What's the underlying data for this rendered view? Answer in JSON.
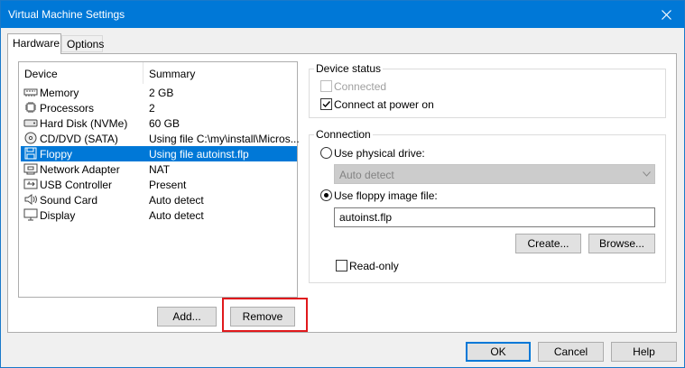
{
  "window": {
    "title": "Virtual Machine Settings"
  },
  "tabs": [
    {
      "label": "Hardware",
      "active": true
    },
    {
      "label": "Options",
      "active": false
    }
  ],
  "device_list": {
    "columns": [
      "Device",
      "Summary"
    ],
    "rows": [
      {
        "device": "Memory",
        "summary": "2 GB",
        "icon": "memory-icon"
      },
      {
        "device": "Processors",
        "summary": "2",
        "icon": "processor-icon"
      },
      {
        "device": "Hard Disk (NVMe)",
        "summary": "60 GB",
        "icon": "hard-disk-icon"
      },
      {
        "device": "CD/DVD (SATA)",
        "summary": "Using file C:\\my\\install\\Micros...",
        "icon": "cd-dvd-icon"
      },
      {
        "device": "Floppy",
        "summary": "Using file autoinst.flp",
        "icon": "floppy-icon",
        "selected": true
      },
      {
        "device": "Network Adapter",
        "summary": "NAT",
        "icon": "network-adapter-icon"
      },
      {
        "device": "USB Controller",
        "summary": "Present",
        "icon": "usb-icon"
      },
      {
        "device": "Sound Card",
        "summary": "Auto detect",
        "icon": "speaker-icon"
      },
      {
        "device": "Display",
        "summary": "Auto detect",
        "icon": "display-icon"
      }
    ]
  },
  "list_buttons": {
    "add": "Add...",
    "remove": "Remove"
  },
  "device_status": {
    "title": "Device status",
    "connected": {
      "label": "Connected",
      "checked": false,
      "disabled": true
    },
    "connect_power_on": {
      "label": "Connect at power on",
      "checked": true
    }
  },
  "connection": {
    "title": "Connection",
    "physical_drive": {
      "label": "Use physical drive:",
      "selected": false
    },
    "drive_select": {
      "value": "Auto detect",
      "disabled": true
    },
    "image_file": {
      "label": "Use floppy image file:",
      "selected": true
    },
    "file_path": "autoinst.flp",
    "create_button": "Create...",
    "browse_button": "Browse...",
    "read_only": {
      "label": "Read-only",
      "checked": false
    }
  },
  "footer": {
    "ok": "OK",
    "cancel": "Cancel",
    "help": "Help"
  },
  "colors": {
    "title_bar": "#0078d7",
    "selection": "#0078d7",
    "highlight": "#e0191c"
  }
}
